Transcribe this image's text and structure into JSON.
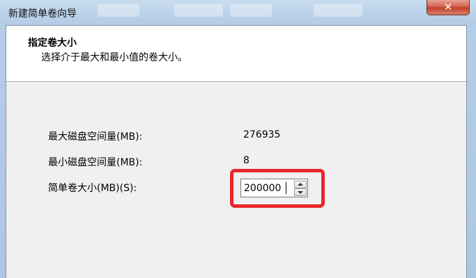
{
  "window": {
    "title": "新建简单卷向导",
    "close_glyph": "✕"
  },
  "header": {
    "title": "指定卷大小",
    "subtitle": "选择介于最大和最小值的卷大小。"
  },
  "fields": {
    "max_label": "最大磁盘空间量(MB):",
    "max_value": "276935",
    "min_label": "最小磁盘空间量(MB):",
    "min_value": "8",
    "size_label": "简单卷大小(MB)(S):",
    "size_value": "200000"
  },
  "colors": {
    "highlight": "#e8262b"
  },
  "icons": {
    "close": "close-icon",
    "spin_up": "chevron-up-icon",
    "spin_down": "chevron-down-icon"
  }
}
